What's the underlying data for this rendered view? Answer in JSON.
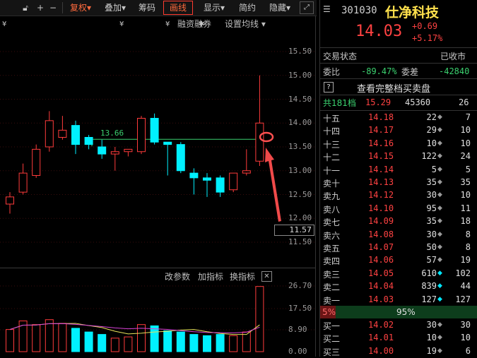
{
  "toolbar": {
    "items": [
      "复权",
      "叠加",
      "筹码",
      "画线",
      "显示",
      "简约",
      "隐藏"
    ],
    "icons": [
      "lock-icon",
      "plus-icon",
      "minus-icon",
      "expand-icon"
    ]
  },
  "chart_header": {
    "financing": "融资融券",
    "ma_settings": "设置均线"
  },
  "price_axis": [
    "15.50",
    "15.00",
    "14.50",
    "14.00",
    "13.50",
    "13.00",
    "12.50",
    "12.00",
    "11.50"
  ],
  "current_tag": "11.57",
  "ma_line_label": "13.66",
  "lower_panel": {
    "change_params": "改参数",
    "add_indicator": "加指标",
    "switch_indicator": "换指标",
    "axis": [
      "26.70",
      "17.50",
      "8.90",
      "0.00"
    ]
  },
  "chart_data": {
    "type": "candlestick",
    "candles": [
      {
        "o": 12.3,
        "h": 12.55,
        "l": 12.1,
        "c": 12.45
      },
      {
        "o": 12.55,
        "h": 13.15,
        "l": 12.5,
        "c": 12.95
      },
      {
        "o": 12.9,
        "h": 13.55,
        "l": 12.85,
        "c": 13.45
      },
      {
        "o": 13.5,
        "h": 14.25,
        "l": 13.4,
        "c": 14.05
      },
      {
        "o": 13.7,
        "h": 14.15,
        "l": 13.65,
        "c": 13.85
      },
      {
        "o": 13.95,
        "h": 14.05,
        "l": 13.35,
        "c": 13.55
      },
      {
        "o": 13.7,
        "h": 13.75,
        "l": 13.45,
        "c": 13.55
      },
      {
        "o": 13.5,
        "h": 13.65,
        "l": 13.25,
        "c": 13.35
      },
      {
        "o": 13.35,
        "h": 13.5,
        "l": 13.0,
        "c": 13.4
      },
      {
        "o": 13.4,
        "h": 13.45,
        "l": 13.3,
        "c": 13.45
      },
      {
        "o": 13.4,
        "h": 14.15,
        "l": 13.35,
        "c": 14.1
      },
      {
        "o": 14.1,
        "h": 14.2,
        "l": 13.55,
        "c": 13.6
      },
      {
        "o": 13.6,
        "h": 13.6,
        "l": 12.9,
        "c": 13.55
      },
      {
        "o": 13.55,
        "h": 13.6,
        "l": 12.95,
        "c": 13.0
      },
      {
        "o": 12.95,
        "h": 13.05,
        "l": 12.5,
        "c": 12.85
      },
      {
        "o": 12.85,
        "h": 12.95,
        "l": 12.45,
        "c": 12.8
      },
      {
        "o": 12.85,
        "h": 12.9,
        "l": 12.45,
        "c": 12.55
      },
      {
        "o": 12.6,
        "h": 12.95,
        "l": 12.55,
        "c": 12.95
      },
      {
        "o": 12.95,
        "h": 13.45,
        "l": 12.9,
        "c": 13.0
      },
      {
        "o": 13.2,
        "h": 15.0,
        "l": 13.1,
        "c": 14.0
      }
    ],
    "volume": [
      9.0,
      12.5,
      11.0,
      13.0,
      11.5,
      9.5,
      8.0,
      7.0,
      5.5,
      6.0,
      11.0,
      10.5,
      8.5,
      8.0,
      7.0,
      6.5,
      7.0,
      6.5,
      8.0,
      26.5
    ],
    "volume_ylim": [
      0,
      26.7
    ],
    "ylim": [
      11.4,
      15.6
    ]
  },
  "quote": {
    "code": "301030",
    "name": "仕净科技",
    "price": "14.03",
    "change": "+0.69",
    "change_pct": "+5.17%",
    "status_label": "交易状态",
    "status": "已收市",
    "ratio_label": "委比",
    "ratio": "-89.47%",
    "diff_label": "委差",
    "diff": "-42840",
    "full_book": "查看完整档买卖盘",
    "full_book_icon": "?",
    "total_label": "共181档",
    "total_price": "15.29",
    "total_vol": "45360",
    "total_n": "26"
  },
  "asks": [
    {
      "label": "十五",
      "price": "14.18",
      "vol": "22",
      "n": "7",
      "dot": "gray"
    },
    {
      "label": "十四",
      "price": "14.17",
      "vol": "29",
      "n": "10",
      "dot": "gray"
    },
    {
      "label": "十三",
      "price": "14.16",
      "vol": "10",
      "n": "10",
      "dot": "gray"
    },
    {
      "label": "十二",
      "price": "14.15",
      "vol": "122",
      "n": "24",
      "dot": "gray"
    },
    {
      "label": "十一",
      "price": "14.14",
      "vol": "5",
      "n": "5",
      "dot": "gray"
    },
    {
      "label": "卖十",
      "price": "14.13",
      "vol": "35",
      "n": "35",
      "dot": "gray"
    },
    {
      "label": "卖九",
      "price": "14.12",
      "vol": "30",
      "n": "10",
      "dot": "gray"
    },
    {
      "label": "卖八",
      "price": "14.10",
      "vol": "95",
      "n": "11",
      "dot": "gray"
    },
    {
      "label": "卖七",
      "price": "14.09",
      "vol": "35",
      "n": "18",
      "dot": "gray"
    },
    {
      "label": "卖六",
      "price": "14.08",
      "vol": "30",
      "n": "8",
      "dot": "gray"
    },
    {
      "label": "卖五",
      "price": "14.07",
      "vol": "50",
      "n": "8",
      "dot": "gray"
    },
    {
      "label": "卖四",
      "price": "14.06",
      "vol": "57",
      "n": "19",
      "dot": "gray"
    },
    {
      "label": "卖三",
      "price": "14.05",
      "vol": "610",
      "n": "102",
      "dot": "cyan"
    },
    {
      "label": "卖二",
      "price": "14.04",
      "vol": "839",
      "n": "44",
      "dot": "cyan"
    },
    {
      "label": "卖一",
      "price": "14.03",
      "vol": "127",
      "n": "127",
      "dot": "cyan"
    }
  ],
  "bar": {
    "left": "5%",
    "right": "95%"
  },
  "bids": [
    {
      "label": "买一",
      "price": "14.02",
      "vol": "30",
      "n": "30",
      "dot": "gray"
    },
    {
      "label": "买二",
      "price": "14.01",
      "vol": "10",
      "n": "10",
      "dot": "gray"
    },
    {
      "label": "买三",
      "price": "14.00",
      "vol": "19",
      "n": "6",
      "dot": "gray"
    }
  ],
  "colors": {
    "up": "#ff3b3b",
    "down": "#00f0ff",
    "bg": "#000000",
    "accent": "#ff6a3d"
  }
}
